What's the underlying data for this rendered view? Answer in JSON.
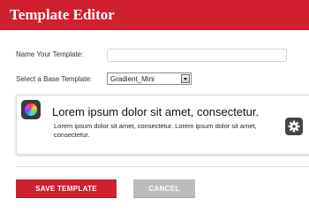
{
  "header": {
    "title": "Template Editor"
  },
  "form": {
    "name_label": "Name Your Template:",
    "name_value": "",
    "base_label": "Select a Base Template:",
    "base_selected": "Gradient_Mini"
  },
  "preview": {
    "heading": "Lorem ipsum dolor sit amet, consectetur.",
    "body": "Lorem ipsum dolor sit amet, consectetur. Lorem ipsum dolor sit amet, consectetur."
  },
  "actions": {
    "save_label": "SAVE TEMPLATE",
    "cancel_label": "CANCEL"
  },
  "colors": {
    "brand": "#d0202e",
    "cancel": "#bcbcbc"
  },
  "icons": {
    "app": "color-wheel-icon",
    "settings": "gear-icon"
  }
}
